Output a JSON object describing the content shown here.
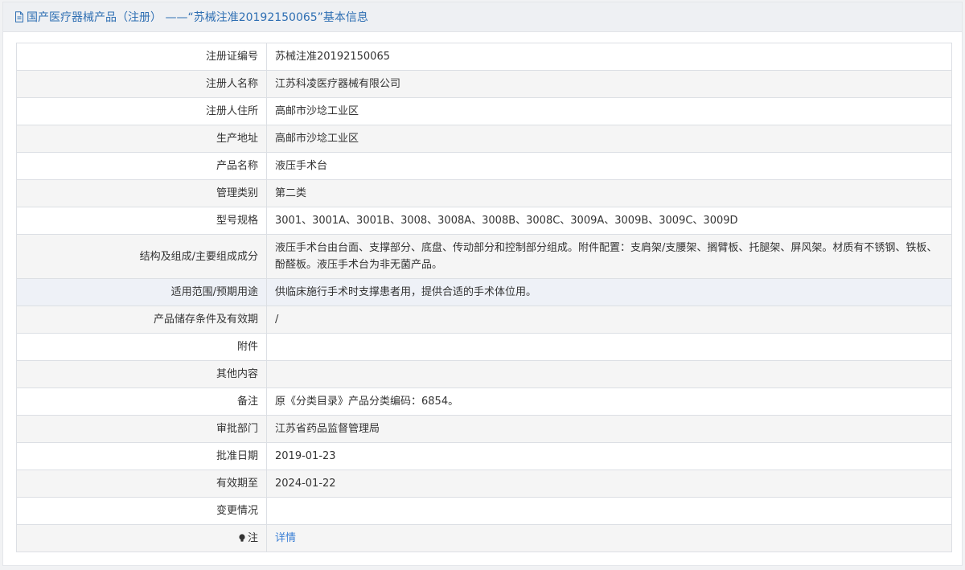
{
  "header": {
    "icon": "document-icon",
    "title": "国产医疗器械产品（注册） ——“苏械注准20192150065”基本信息"
  },
  "rows": [
    {
      "label": "注册证编号",
      "value": "苏械注准20192150065"
    },
    {
      "label": "注册人名称",
      "value": "江苏科凌医疗器械有限公司"
    },
    {
      "label": "注册人住所",
      "value": "高邮市沙埝工业区"
    },
    {
      "label": "生产地址",
      "value": "高邮市沙埝工业区"
    },
    {
      "label": "产品名称",
      "value": "液压手术台"
    },
    {
      "label": "管理类别",
      "value": "第二类"
    },
    {
      "label": "型号规格",
      "value": "3001、3001A、3001B、3008、3008A、3008B、3008C、3009A、3009B、3009C、3009D"
    },
    {
      "label": "结构及组成/主要组成成分",
      "value": "液压手术台由台面、支撑部分、底盘、传动部分和控制部分组成。附件配置：支肩架/支腰架、搁臂板、托腿架、屏风架。材质有不锈钢、铁板、酚醛板。液压手术台为非无菌产品。"
    },
    {
      "label": "适用范围/预期用途",
      "value": "供临床施行手术时支撑患者用，提供合适的手术体位用。"
    },
    {
      "label": "产品储存条件及有效期",
      "value": "/"
    },
    {
      "label": "附件",
      "value": ""
    },
    {
      "label": "其他内容",
      "value": ""
    },
    {
      "label": "备注",
      "value": "原《分类目录》产品分类编码：6854。"
    },
    {
      "label": "审批部门",
      "value": "江苏省药品监督管理局"
    },
    {
      "label": "批准日期",
      "value": "2019-01-23"
    },
    {
      "label": "有效期至",
      "value": "2024-01-22"
    },
    {
      "label": "变更情况",
      "value": ""
    },
    {
      "label": "注",
      "icon": "lightbulb-icon",
      "value": "详情"
    }
  ],
  "colors": {
    "header_text": "#2f6fb3",
    "link": "#3a7fd5",
    "border": "#dcdfe4"
  }
}
